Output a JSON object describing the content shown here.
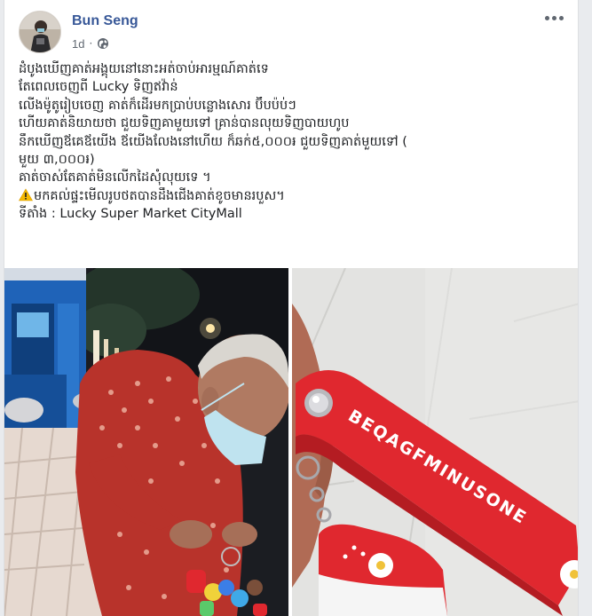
{
  "post": {
    "author": "Bun Seng",
    "time": "1d",
    "separator": "·",
    "privacy_icon": "globe-icon",
    "more_icon": "ellipsis-icon",
    "lines": [
      "ដំបូងឃើញគាត់អង្គុយនៅនោះអត់ចាប់អារម្មណ៍គាត់ទេ",
      "តែពេលចេញពី Lucky ទិញឥវ៉ាន់",
      "លើងម៉ូតូរៀបចេញ គាត់ក៏ដើរមកប្រាប់បន្លោងសោរ ប៊ីបប៉ប់ៗ",
      "ហើយគាត់និយាយថា ជួយទិញគាមួយទៅ គ្រាន់បានលុយទិញបាយហូប",
      "នឹកឃើញឪគេឪយើង ឪយើងលែងនៅហើយ ក៏ឆក់៥,០០០៛ ជួយទិញគាត់មួយទៅ (",
      "មួយ ៣,០០០៛)",
      "គាត់ចាស់តែគាត់មិនលើកដៃសុំលុយទេ ។"
    ],
    "warning_line": "មកគល់ផ្ទះមើលរូបថតបានដឹងជើងគាត់ខូចមានរបួស។",
    "location_line": "ទីតាំង : Lucky Super Market CityMall"
  },
  "photos": {
    "left_icon": "photo-old-man-selling-keychains",
    "right_icon": "photo-red-keychain",
    "keychain_text": "BEQAGFMINUSONE"
  },
  "colors": {
    "author_link": "#385898",
    "meta_gray": "#606770",
    "background": "#e9ebee",
    "keychain_red": "#e0282f"
  }
}
